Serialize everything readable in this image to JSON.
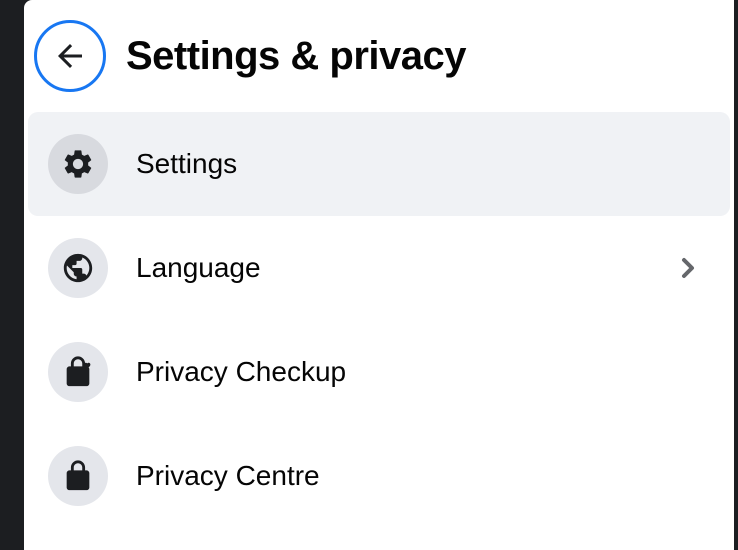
{
  "header": {
    "title": "Settings & privacy"
  },
  "menu": {
    "items": [
      {
        "label": "Settings"
      },
      {
        "label": "Language"
      },
      {
        "label": "Privacy Checkup"
      },
      {
        "label": "Privacy Centre"
      }
    ]
  }
}
